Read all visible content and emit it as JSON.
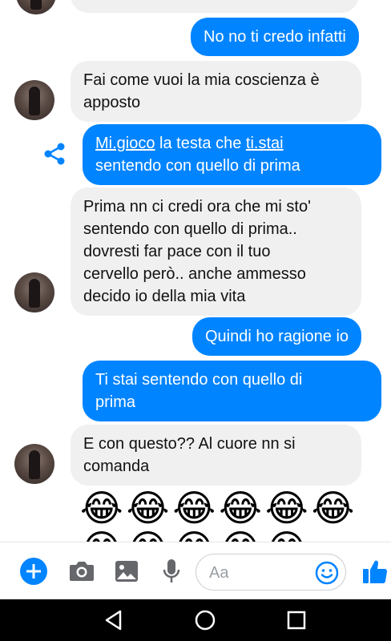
{
  "messages": [
    {
      "side": "out",
      "lines": [
        "No no ti credo infatti"
      ]
    },
    {
      "side": "in",
      "lines": [
        "Fai come vuoi la mia coscienza è",
        "apposto"
      ]
    },
    {
      "side": "out",
      "line1_a": "Mi.gioco",
      "line1_b": " la testa che ",
      "line1_c": "ti.stai",
      "line2": "sentendo con quello di prima"
    },
    {
      "side": "in",
      "lines": [
        "Prima nn ci credi ora che mi sto'",
        "sentendo con quello di prima..",
        "dovresti far pace con il tuo",
        "cervello però.. anche ammesso",
        "decido io della mia vita"
      ]
    },
    {
      "side": "out",
      "lines": [
        "Quindi ho ragione io"
      ]
    },
    {
      "side": "out",
      "lines": [
        "Ti stai sentendo con quello di",
        "prima"
      ]
    },
    {
      "side": "in",
      "lines": [
        "E con questo?? Al cuore nn si",
        "comanda"
      ]
    }
  ],
  "emoji_row1": "😂😂😂😂😂😂",
  "emoji_row2": "😂😂😂😂😂",
  "composer": {
    "placeholder": "Aa"
  },
  "colors": {
    "accent": "#0084ff",
    "incoming_bubble": "#f1f0f0"
  },
  "icons": [
    "plus-icon",
    "camera-icon",
    "image-icon",
    "microphone-icon",
    "smiley-icon",
    "thumbs-up-icon",
    "share-icon",
    "back-icon",
    "home-icon",
    "recents-icon"
  ]
}
